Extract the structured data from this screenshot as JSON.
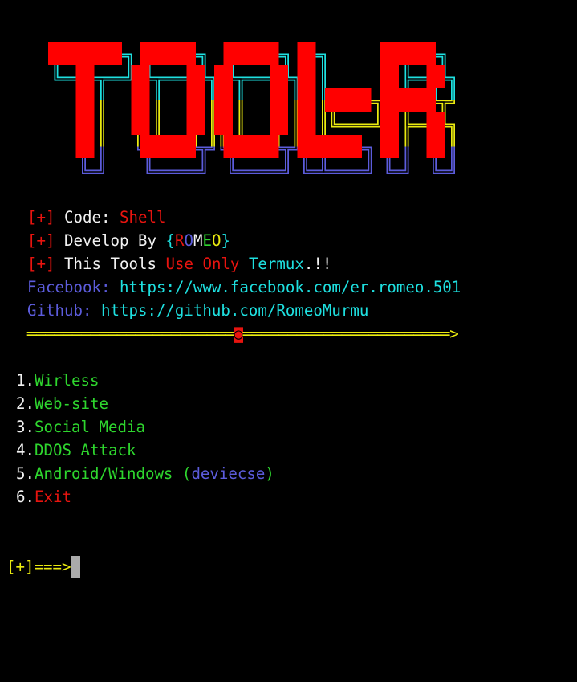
{
  "logo": {
    "text": "TOOL-R"
  },
  "info": {
    "bullet": "[+]",
    "code_label": "Code:",
    "code_value": "Shell",
    "develop_label": "Develop By",
    "author_open": "{",
    "author_letters": [
      "R",
      "O",
      "M",
      "E",
      "O"
    ],
    "author_close": "}",
    "tools_text": "This Tools",
    "use_only": "Use Only",
    "termux": "Termux",
    "exclaim": ".!!",
    "facebook_label": "Facebook:",
    "facebook_url": "https://www.facebook.com/er.romeo.501",
    "github_label": "Github:",
    "github_url": "https://github.com/RomeoMurmu"
  },
  "separator": {
    "left": "═══════════════════════",
    "marker": "◙",
    "right": "═══════════════════════",
    "arrow": ">"
  },
  "menu": [
    {
      "num": "1.",
      "label": "Wirless"
    },
    {
      "num": "2.",
      "label": "Web-site"
    },
    {
      "num": "3.",
      "label": "Social Media"
    },
    {
      "num": "4.",
      "label": "DDOS Attack"
    },
    {
      "num": "5.",
      "label": "Android/Windows",
      "paren_open": " (",
      "note": "deviecse",
      "paren_close": ")"
    },
    {
      "num": "6.",
      "label": "Exit"
    }
  ],
  "prompt": {
    "text": "[+]===>"
  },
  "colors": {
    "red": "#e8140f",
    "cyan": "#1ee0e0",
    "blue": "#5c5cdc",
    "green": "#2ed62e",
    "yellow": "#eaea10"
  }
}
